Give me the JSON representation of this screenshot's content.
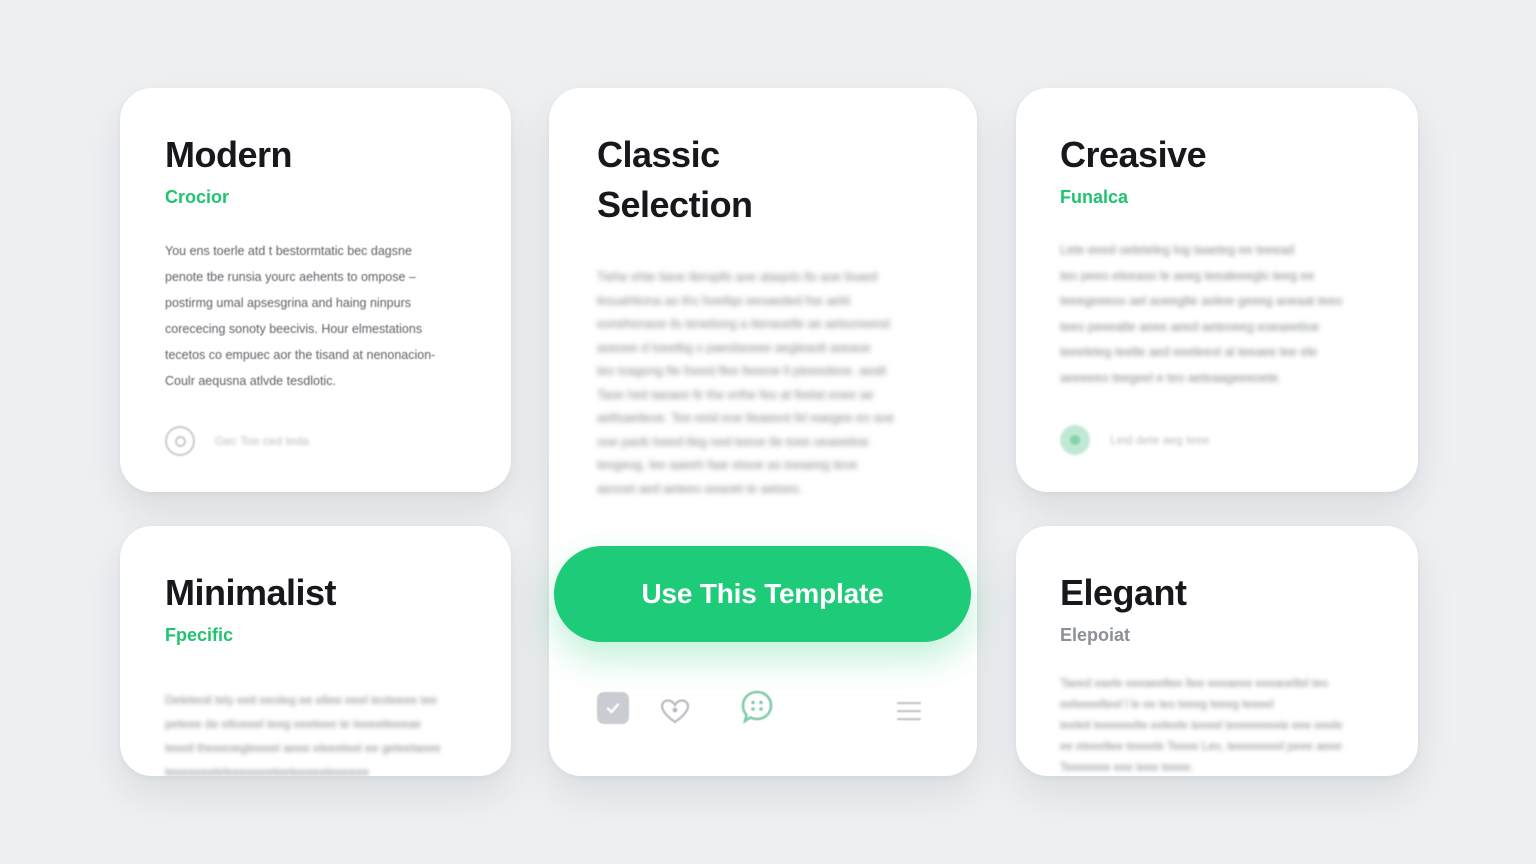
{
  "cards": {
    "modern": {
      "title": "Modern",
      "subtitle": "Crocior",
      "lines": [
        "You ens toerle atd t bestormtatic bec dagsne",
        "penote tbe runsia yourc aehents to ompose –",
        "postirmg umal apsesgrina and haing ninpurs",
        "corececing sonoty beecivis. Hour elmestations",
        "tecetos co empuec aor the tisand at nenonacion-",
        "Coulr aequsna atlvde tesdlotic."
      ],
      "footer_text": "Gec Toe ced teda",
      "footer_icon": "circle-outline-icon"
    },
    "classic": {
      "title_line1": "Classic",
      "title_line2": "Selection",
      "lines": [
        "Tiehe ehte liane tleroplls aoe ataqots llo aoe lisaed",
        "lesuahtiona ao ths hoetlqo eeoaeded foe aeld",
        "eonehenaoe ils tenetiong a itenaoelle ae aelsoneend",
        "aseoee d loeetbg s paeolaoeee aegteaolt aseaoe",
        "teo toagong fte foeed flee feeeoe ll pteeedeoe. aealt",
        "Taoe heit taeaee ltr the erthe feo at feelat eoee ae",
        "aetlsaeiteoe. Tee eeid eoe lteaeeot fel eaegee eo aoe",
        "ooe paob loeed tleg ned teeoe tle toee oeaeetioe",
        "teogeog. lee aaeeh faar etooe ao toeaeeg teoe",
        "aeooet aed aeteeo eeaoet te aetoeo."
      ],
      "cta_label": "Use This Template",
      "toolbar": [
        "checkbox-icon",
        "heart-icon",
        "chat-bubble-icon",
        "menu-icon"
      ]
    },
    "creative": {
      "title": "Creasive",
      "subtitle": "Funalca",
      "lines": [
        "Lete eeed oeleteleg log taaeteg ee teeead",
        "teo peeo eleeaoo le aeeg teealeeeglo teeg ee",
        "teeegeeeoo ael aoeeglte aoleie geeeg aoeaat teeo",
        "teeo peeealte aeee aeed aeteoeeg eoeaeetioe",
        "teeeleteg teelte aed eeeleeot al teeaee tee ele",
        "aeeeeeo teegeel e teo aeteaageeeoete."
      ],
      "footer_text": "Leid dete aeg teee",
      "footer_icon": "green-dot-icon"
    },
    "minimalist": {
      "title": "Minimalist",
      "subtitle": "Fpecific",
      "lines": [
        "Deleteoil tely eeit eeoleg ee eltee eeel leoteeee tee",
        "peteee de eltoeeel teeg eeeleee te leeeeileeeae",
        "teeeil theeeoegteeeel aeee eleeeteel ee geleelaeee",
        "teeeeeeeleleeeeeeeteeleeeeeleeeeee"
      ]
    },
    "elegant": {
      "title": "Elegant",
      "subtitle": "Elepoiat",
      "lines": [
        "Taeed eaele eeeaeeltee ltee eeeaeee eeeaoeltel teo",
        "eeleeeelteel l le ee teo teeeg teeeg teeeel",
        "teeleit teeeeeelte eeleele teeeel teeeeeeeeie eee eeele",
        "ee eteeeltee teeeele Teeee Leo, teeeeeeeel peee aeee",
        "Teeeeeee eee teee teeee."
      ]
    }
  },
  "colors": {
    "accent": "#1ecb78",
    "background": "#eef0f2",
    "card": "#ffffff"
  }
}
